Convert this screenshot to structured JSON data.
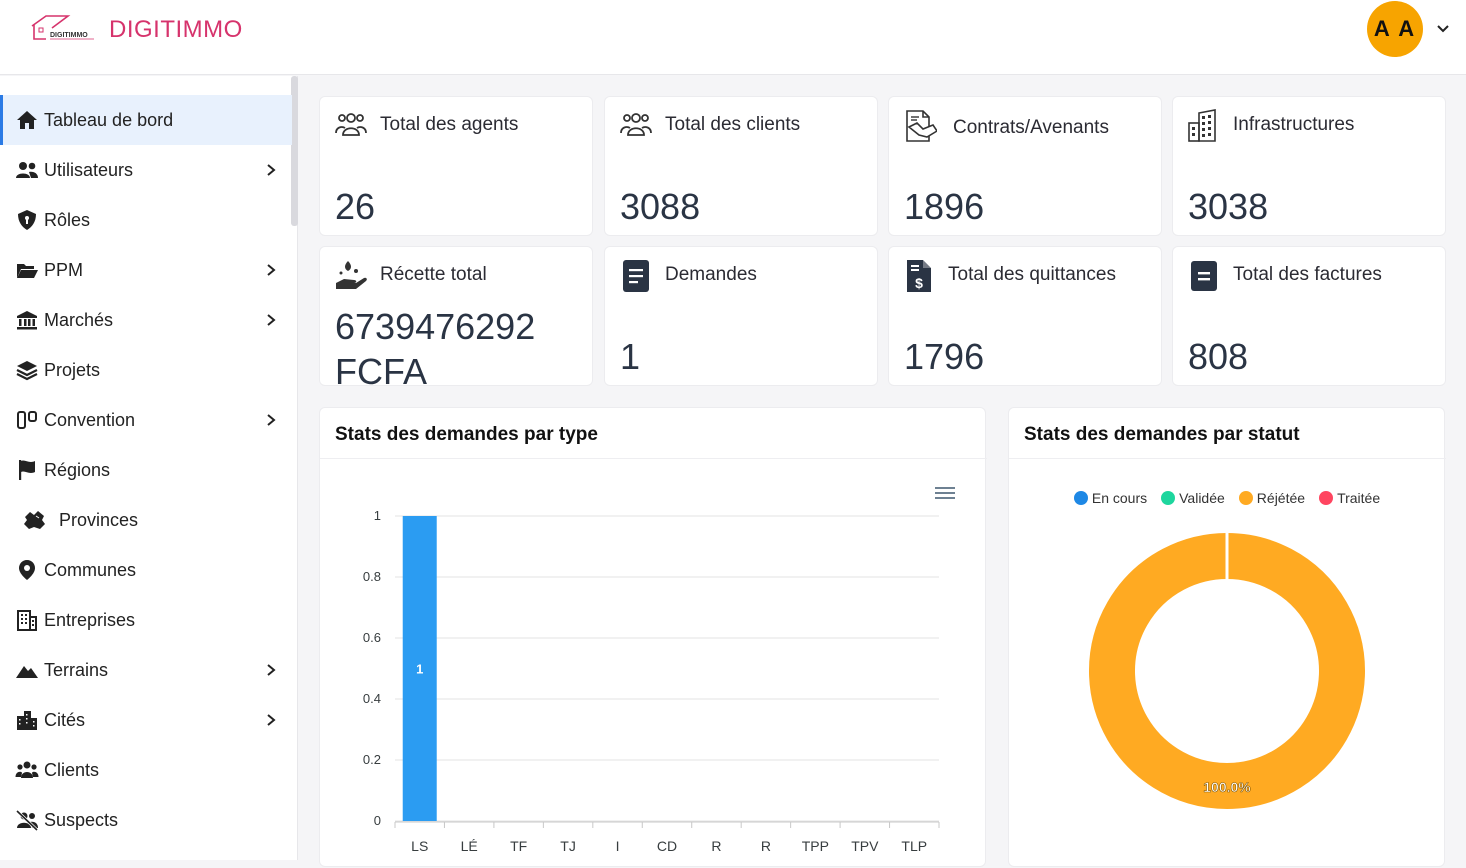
{
  "header": {
    "brand": "DIGITIMMO",
    "logo_text": "DIGITIMMO",
    "avatar_initials": "A A"
  },
  "sidebar": {
    "items": [
      {
        "label": "Tableau de bord",
        "icon": "home-icon",
        "active": true,
        "chevron": false
      },
      {
        "label": "Utilisateurs",
        "icon": "users-icon",
        "active": false,
        "chevron": true
      },
      {
        "label": "Rôles",
        "icon": "shield-icon",
        "active": false,
        "chevron": false
      },
      {
        "label": "PPM",
        "icon": "folder-open-icon",
        "active": false,
        "chevron": true
      },
      {
        "label": "Marchés",
        "icon": "bank-icon",
        "active": false,
        "chevron": true
      },
      {
        "label": "Projets",
        "icon": "layers-icon",
        "active": false,
        "chevron": false
      },
      {
        "label": "Convention",
        "icon": "columns-icon",
        "active": false,
        "chevron": true
      },
      {
        "label": "Régions",
        "icon": "flag-icon",
        "active": false,
        "chevron": false
      },
      {
        "label": "Provinces",
        "icon": "map-icon",
        "active": false,
        "chevron": false
      },
      {
        "label": "Communes",
        "icon": "location-pin-icon",
        "active": false,
        "chevron": false
      },
      {
        "label": "Entreprises",
        "icon": "building-icon",
        "active": false,
        "chevron": false
      },
      {
        "label": "Terrains",
        "icon": "mountain-icon",
        "active": false,
        "chevron": true
      },
      {
        "label": "Cités",
        "icon": "city-icon",
        "active": false,
        "chevron": true
      },
      {
        "label": "Clients",
        "icon": "people-group-icon",
        "active": false,
        "chevron": false
      },
      {
        "label": "Suspects",
        "icon": "users-slash-icon",
        "active": false,
        "chevron": false
      }
    ]
  },
  "cards": [
    {
      "title": "Total des agents",
      "value": "26",
      "icon": "group-outline-icon"
    },
    {
      "title": "Total des clients",
      "value": "3088",
      "icon": "group-outline-icon"
    },
    {
      "title": "Contrats/Avenants",
      "value": "1896",
      "icon": "contract-icon"
    },
    {
      "title": "Infrastructures",
      "value": "3038",
      "icon": "buildings-icon"
    },
    {
      "title": "Récette total",
      "value": "6739476292",
      "value2": "FCFA",
      "icon": "hand-money-icon"
    },
    {
      "title": "Demandes",
      "value": "1",
      "icon": "document-icon"
    },
    {
      "title": "Total des quittances",
      "value": "1796",
      "icon": "invoice-dollar-icon"
    },
    {
      "title": "Total des factures",
      "value": "808",
      "icon": "invoice-icon"
    }
  ],
  "panels": {
    "bar_title": "Stats des demandes par type",
    "donut_title": "Stats des demandes par statut"
  },
  "chart_data": [
    {
      "type": "bar",
      "title": "Stats des demandes par type",
      "categories": [
        "LS",
        "LÉ",
        "TF",
        "TJ",
        "I",
        "CD",
        "R",
        "R",
        "TPP",
        "TPV",
        "TLP"
      ],
      "values": [
        1,
        0,
        0,
        0,
        0,
        0,
        0,
        0,
        0,
        0,
        0
      ],
      "data_labels": [
        "1",
        "",
        "",
        "",
        "",
        "",
        "",
        "",
        "",
        "",
        ""
      ],
      "ylim": [
        0,
        1
      ],
      "yticks": [
        "0",
        "0.2",
        "0.4",
        "0.6",
        "0.8",
        "1"
      ],
      "color": "#2b9cf2",
      "grid": true
    },
    {
      "type": "pie",
      "title": "Stats des demandes par statut",
      "labels": [
        "En cours",
        "Validée",
        "Réjétée",
        "Traitée"
      ],
      "values": [
        0,
        0,
        1,
        0
      ],
      "colors": [
        "#1e88e5",
        "#1ed69e",
        "#ffaa22",
        "#ff4560"
      ],
      "data_label": "100.0%",
      "legend": "top"
    }
  ]
}
